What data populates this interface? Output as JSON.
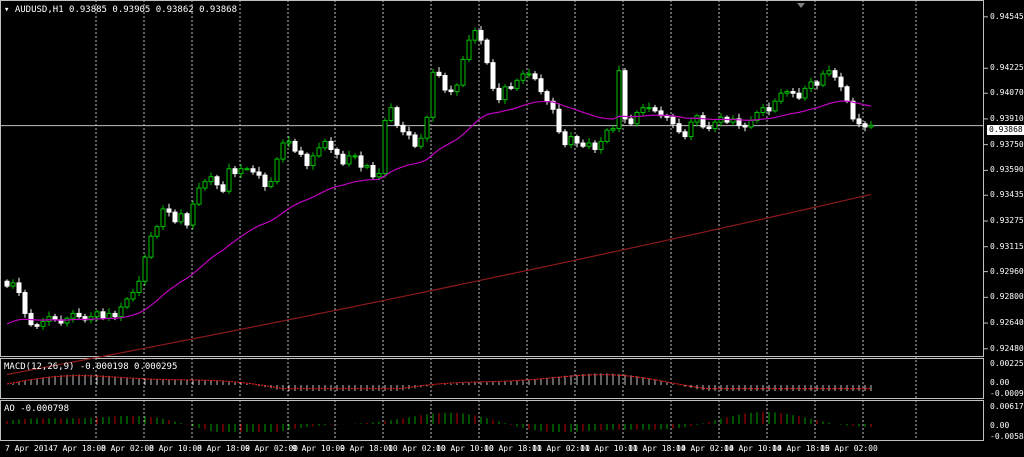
{
  "symbol": "AUDUSD,H1",
  "ohlc": "0.93885 0.93905 0.93862 0.93868",
  "current_price": "0.93868",
  "price_axis": [
    "0.94545",
    "0.94225",
    "0.94070",
    "0.93910",
    "0.93750",
    "0.93590",
    "0.93435",
    "0.93275",
    "0.93115",
    "0.92960",
    "0.92800",
    "0.92640",
    "0.92480"
  ],
  "macd_label": "MACD(12,26,9) -0.000198 0.000295",
  "macd_axis": [
    "0.002252",
    "0.00",
    "-0.00090"
  ],
  "ao_label": "AO -0.000798",
  "ao_axis": [
    "0.006179",
    "0.00",
    "-0.00580"
  ],
  "time_axis": [
    "7 Apr 2014",
    "7 Apr 18:00",
    "8 Apr 02:00",
    "8 Apr 10:00",
    "8 Apr 18:00",
    "9 Apr 02:00",
    "9 Apr 10:00",
    "9 Apr 18:00",
    "10 Apr 02:00",
    "10 Apr 10:00",
    "10 Apr 18:00",
    "11 Apr 02:00",
    "11 Apr 10:00",
    "11 Apr 18:00",
    "14 Apr 02:00",
    "14 Apr 10:00",
    "14 Apr 18:00",
    "15 Apr 02:00"
  ],
  "colors": {
    "up": "#00c000",
    "down": "#ffffff",
    "ma_fast": "#c000c0",
    "ma_slow": "#8b1a1a",
    "grid": "#c0c0c0",
    "histo": "#c0c0c0",
    "signal": "#ff2020",
    "ao_up": "#00a000",
    "ao_down": "#c00000"
  },
  "chart_data": {
    "type": "candlestick",
    "closes": [
      0.9287,
      0.9289,
      0.9283,
      0.927,
      0.9263,
      0.9262,
      0.9265,
      0.9268,
      0.9266,
      0.9264,
      0.9267,
      0.927,
      0.9268,
      0.9266,
      0.9268,
      0.9271,
      0.9267,
      0.927,
      0.9268,
      0.9274,
      0.9279,
      0.9283,
      0.929,
      0.9305,
      0.9318,
      0.9324,
      0.9335,
      0.9333,
      0.9327,
      0.9332,
      0.9325,
      0.9338,
      0.9348,
      0.9352,
      0.9355,
      0.935,
      0.9346,
      0.936,
      0.9357,
      0.936,
      0.936,
      0.9358,
      0.9356,
      0.9349,
      0.9352,
      0.9366,
      0.9376,
      0.9377,
      0.9371,
      0.9369,
      0.9362,
      0.9368,
      0.9373,
      0.9377,
      0.9372,
      0.9369,
      0.9363,
      0.9368,
      0.9368,
      0.9361,
      0.9362,
      0.9355,
      0.9357,
      0.939,
      0.9398,
      0.9387,
      0.9383,
      0.9381,
      0.9374,
      0.9379,
      0.9392,
      0.942,
      0.9418,
      0.9409,
      0.9408,
      0.9412,
      0.9428,
      0.944,
      0.9446,
      0.944,
      0.9426,
      0.941,
      0.9403,
      0.9411,
      0.941,
      0.9415,
      0.9419,
      0.9419,
      0.9416,
      0.9408,
      0.9402,
      0.9397,
      0.9383,
      0.9375,
      0.938,
      0.9376,
      0.9374,
      0.9376,
      0.9372,
      0.9377,
      0.9384,
      0.9385,
      0.9421,
      0.9391,
      0.9388,
      0.9395,
      0.9398,
      0.9398,
      0.9396,
      0.9393,
      0.9392,
      0.9388,
      0.9383,
      0.938,
      0.9389,
      0.9393,
      0.9386,
      0.9385,
      0.9389,
      0.9392,
      0.9389,
      0.9391,
      0.9387,
      0.9386,
      0.939,
      0.9395,
      0.9398,
      0.9396,
      0.9402,
      0.9407,
      0.9408,
      0.9407,
      0.9404,
      0.941,
      0.9414,
      0.9412,
      0.9419,
      0.9421,
      0.9417,
      0.9411,
      0.9402,
      0.9391,
      0.9388,
      0.9386,
      0.9387
    ],
    "ma_fast_start": 0.9262,
    "ma_slow_start": 0.9232,
    "ma_slow_end": 0.9344,
    "ylim": [
      0.9246,
      0.946
    ]
  }
}
